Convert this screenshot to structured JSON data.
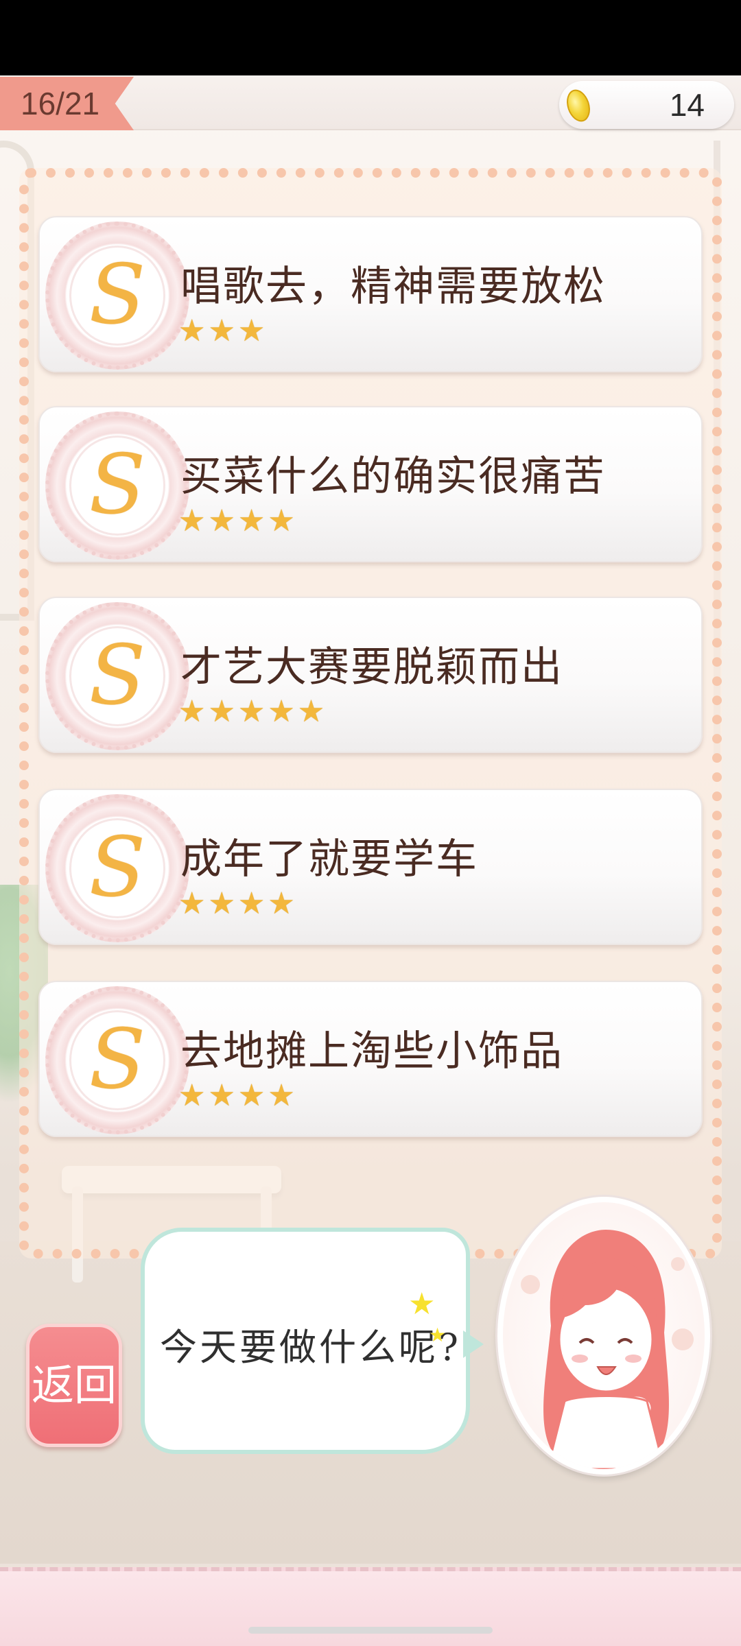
{
  "header": {
    "progress": "16/21",
    "coins": "14",
    "coin_icon": "gold-coin-icon"
  },
  "options": [
    {
      "title": "唱歌去，精神需要放松",
      "stars": "★★★",
      "rating": 3,
      "icon": "swirl-s-badge-icon"
    },
    {
      "title": "买菜什么的确实很痛苦",
      "stars": "★★★★",
      "rating": 4,
      "icon": "swirl-s-badge-icon"
    },
    {
      "title": "才艺大赛要脱颖而出",
      "stars": "★★★★★",
      "rating": 5,
      "icon": "swirl-s-badge-icon"
    },
    {
      "title": "成年了就要学车",
      "stars": "★★★★",
      "rating": 4,
      "icon": "swirl-s-badge-icon"
    },
    {
      "title": "去地摊上淘些小饰品",
      "stars": "★★★★",
      "rating": 4,
      "icon": "swirl-s-badge-icon"
    }
  ],
  "dialog": {
    "speech": "今天要做什么呢?",
    "back_label": "返回"
  },
  "colors": {
    "accent_pink": "#ef6f76",
    "star_gold": "#f3b73c",
    "text_brown": "#4a2b22",
    "panel_border": "#f7c6ab",
    "bubble_border": "#bfe6db"
  }
}
